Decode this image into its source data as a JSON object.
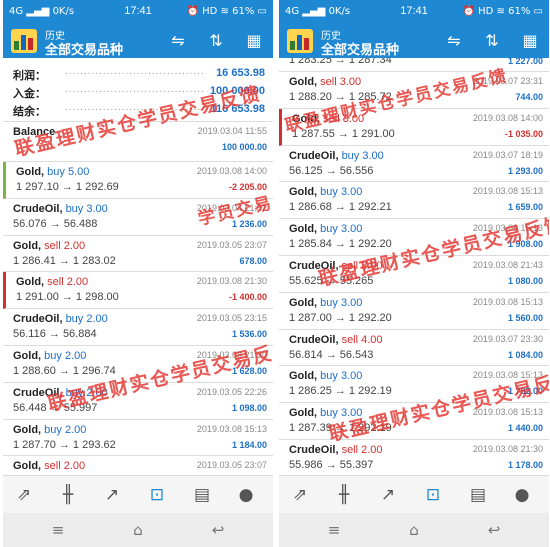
{
  "status_bar": {
    "signal": "4G",
    "speed": "0K/s",
    "time": "17:41",
    "hd": "HD",
    "battery": "61%"
  },
  "app_bar": {
    "subtitle": "历史",
    "title": "全部交易品种"
  },
  "summary": [
    {
      "label": "利润：",
      "value": "16 653.98"
    },
    {
      "label": "入金：",
      "value": "100 000.00"
    },
    {
      "label": "结余：",
      "value": "116 653.98"
    }
  ],
  "balance": {
    "label": "Balance",
    "date": "2019.03.04 11:55",
    "value": "100 000.00"
  },
  "left_trades": [
    {
      "symbol": "Gold, ",
      "side": "buy 5.00",
      "side_type": "buy",
      "prices": "1 297.10 → 1 292.69",
      "date": "2019.03.08 14:00",
      "profit": "-2 205.00",
      "mark": "green"
    },
    {
      "symbol": "CrudeOil, ",
      "side": "buy 3.00",
      "side_type": "buy",
      "prices": "56.076 → 56.488",
      "date": "2019.03.04 21:52",
      "profit": "1 236.00",
      "mark": ""
    },
    {
      "symbol": "Gold, ",
      "side": "sell 2.00",
      "side_type": "sell",
      "prices": "1 286.41 → 1 283.02",
      "date": "2019.03.05 23:07",
      "profit": "678.00",
      "mark": ""
    },
    {
      "symbol": "Gold, ",
      "side": "sell 2.00",
      "side_type": "sell",
      "prices": "1 291.00 → 1 298.00",
      "date": "2019.03.08 21:30",
      "profit": "-1 400.00",
      "mark": "red"
    },
    {
      "symbol": "CrudeOil, ",
      "side": "buy 2.00",
      "side_type": "buy",
      "prices": "56.116 → 56.884",
      "date": "2019.03.05 23:15",
      "profit": "1 536.00",
      "mark": ""
    },
    {
      "symbol": "Gold, ",
      "side": "buy 2.00",
      "side_type": "buy",
      "prices": "1 288.60 → 1 296.74",
      "date": "2019.03.08 21:30",
      "profit": "1 628.00",
      "mark": ""
    },
    {
      "symbol": "CrudeOil, ",
      "side": "buy 2.00",
      "side_type": "buy",
      "prices": "56.448 → 55.997",
      "date": "2019.03.05 22:26",
      "profit": "1 098.00",
      "mark": ""
    },
    {
      "symbol": "Gold, ",
      "side": "buy 2.00",
      "side_type": "buy",
      "prices": "1 287.70 → 1 293.62",
      "date": "2019.03.08 15:13",
      "profit": "1 184.00",
      "mark": ""
    },
    {
      "symbol": "Gold, ",
      "side": "sell 2.00",
      "side_type": "sell",
      "prices": "",
      "date": "2019.03.05 23:07",
      "profit": "",
      "mark": ""
    }
  ],
  "right_partial": {
    "prices": "1 283.25 → 1 287.34",
    "profit": "1 227.00"
  },
  "right_trades": [
    {
      "symbol": "Gold, ",
      "side": "sell 3.00",
      "side_type": "sell",
      "prices": "1 288.20 → 1 285.72",
      "date": "2019.03.07 23:31",
      "profit": "744.00",
      "mark": ""
    },
    {
      "symbol": "Gold, ",
      "side": "sell 3.00",
      "side_type": "sell",
      "prices": "1 287.55 → 1 291.00",
      "date": "2019.03.08 14:00",
      "profit": "-1 035.00",
      "mark": "red"
    },
    {
      "symbol": "CrudeOil, ",
      "side": "buy 3.00",
      "side_type": "buy",
      "prices": "56.125 → 56.556",
      "date": "2019.03.07 18:19",
      "profit": "1 293.00",
      "mark": ""
    },
    {
      "symbol": "Gold, ",
      "side": "buy 3.00",
      "side_type": "buy",
      "prices": "1 286.68 → 1 292.21",
      "date": "2019.03.08 15:13",
      "profit": "1 659.00",
      "mark": ""
    },
    {
      "symbol": "Gold, ",
      "side": "buy 3.00",
      "side_type": "buy",
      "prices": "1 285.84 → 1 292.20",
      "date": "2019.03.08 15:13",
      "profit": "1 908.00",
      "mark": ""
    },
    {
      "symbol": "CrudeOil, ",
      "side": "sell 3.00",
      "side_type": "sell",
      "prices": "55.625 → 55.265",
      "date": "2019.03.08 21:43",
      "profit": "1 080.00",
      "mark": ""
    },
    {
      "symbol": "Gold, ",
      "side": "buy 3.00",
      "side_type": "buy",
      "prices": "1 287.00 → 1 292.20",
      "date": "2019.03.08 15:13",
      "profit": "1 560.00",
      "mark": ""
    },
    {
      "symbol": "CrudeOil, ",
      "side": "sell 4.00",
      "side_type": "sell",
      "prices": "56.814 → 56.543",
      "date": "2019.03.07 23:30",
      "profit": "1 084.00",
      "mark": ""
    },
    {
      "symbol": "Gold, ",
      "side": "buy 3.00",
      "side_type": "buy",
      "prices": "1 286.25 → 1 292.19",
      "date": "2019.03.08 15:13",
      "profit": "1 782.00",
      "mark": ""
    },
    {
      "symbol": "Gold, ",
      "side": "buy 3.00",
      "side_type": "buy",
      "prices": "1 287.39 → 1 292.19",
      "date": "2019.03.08 15:13",
      "profit": "1 440.00",
      "mark": ""
    },
    {
      "symbol": "CrudeOil, ",
      "side": "sell 2.00",
      "side_type": "sell",
      "prices": "55.986 → 55.397",
      "date": "2019.03.08 21:30",
      "profit": "1 178.00",
      "mark": ""
    }
  ],
  "watermark_text": "联盈理财实仓学员交易反馈",
  "watermark_text_short": "学员交易反馈",
  "icons": {
    "app_buttons": [
      "swap-chart-icon",
      "sort-icon",
      "calendar-icon"
    ],
    "tabs": [
      "quotes-icon",
      "chart-icon",
      "trade-icon",
      "history-icon",
      "news-icon",
      "chat-icon"
    ],
    "nav": [
      "menu-icon",
      "home-icon",
      "back-icon"
    ]
  },
  "colors": {
    "accent": "#1e88d2",
    "profit_positive": "#1e6fc7",
    "profit_negative": "#d32f2f",
    "watermark": "#e53935"
  }
}
